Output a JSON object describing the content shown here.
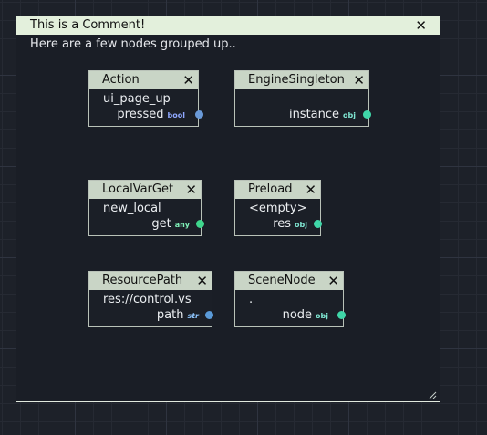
{
  "comment": {
    "title": "This is a Comment!",
    "close": "✕",
    "text": "Here are a few nodes grouped up.."
  },
  "nodes": [
    {
      "title": "Action",
      "close": "✕",
      "input": "ui_page_up",
      "output": "pressed",
      "type": "bool"
    },
    {
      "title": "EngineSingleton",
      "close": "✕",
      "output": "instance",
      "type": "obj"
    },
    {
      "title": "LocalVarGet",
      "close": "✕",
      "input": "new_local",
      "output": "get",
      "type": "any"
    },
    {
      "title": "Preload",
      "close": "✕",
      "input": "<empty>",
      "output": "res",
      "type": "obj"
    },
    {
      "title": "ResourcePath",
      "close": "✕",
      "input": "res://control.vs",
      "output": "path",
      "type": "str"
    },
    {
      "title": "SceneNode",
      "close": "✕",
      "input": ".",
      "output": "node",
      "type": "obj"
    }
  ],
  "colors": {
    "port_bool": "#6a9ad8",
    "port_obj": "#3fd6a8",
    "port_any": "#3fd68c",
    "port_str": "#5a9ad8"
  }
}
